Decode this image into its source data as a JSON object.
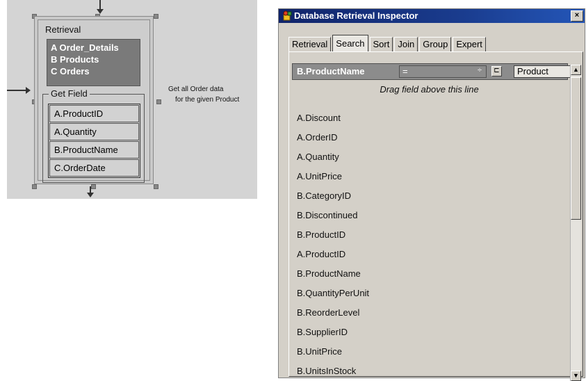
{
  "diagram": {
    "retrieval_title": "Retrieval",
    "tables": [
      "A Order_Details",
      "B Products",
      "C Orders"
    ],
    "get_field_title": "Get Field",
    "fields": [
      "A.ProductID",
      "A.Quantity",
      "B.ProductName",
      "C.OrderDate"
    ],
    "note_line1": "Get all Order data",
    "note_line2": "for the given Product"
  },
  "inspector": {
    "title": "Database Retrieval Inspector",
    "close_label": "×",
    "tabs": [
      {
        "label": "Retrieval",
        "active": false
      },
      {
        "label": "Search",
        "active": true
      },
      {
        "label": "Sort",
        "active": false
      },
      {
        "label": "Join",
        "active": false
      },
      {
        "label": "Group",
        "active": false
      },
      {
        "label": "Expert",
        "active": false
      }
    ],
    "criteria": {
      "field": "B.ProductName",
      "operator": "=",
      "operator_arrow": "÷",
      "checkbox": "⊏",
      "value": "Product"
    },
    "drag_hint": "Drag field above this line",
    "fields": [
      "A.Discount",
      "A.OrderID",
      "A.Quantity",
      "A.UnitPrice",
      "B.CategoryID",
      "B.Discontinued",
      "B.ProductID",
      "A.ProductID",
      "B.ProductName",
      "B.QuantityPerUnit",
      "B.ReorderLevel",
      "B.SupplierID",
      "B.UnitPrice",
      "B.UnitsInStock"
    ],
    "scroll_up": "▲",
    "scroll_down": "▼"
  }
}
